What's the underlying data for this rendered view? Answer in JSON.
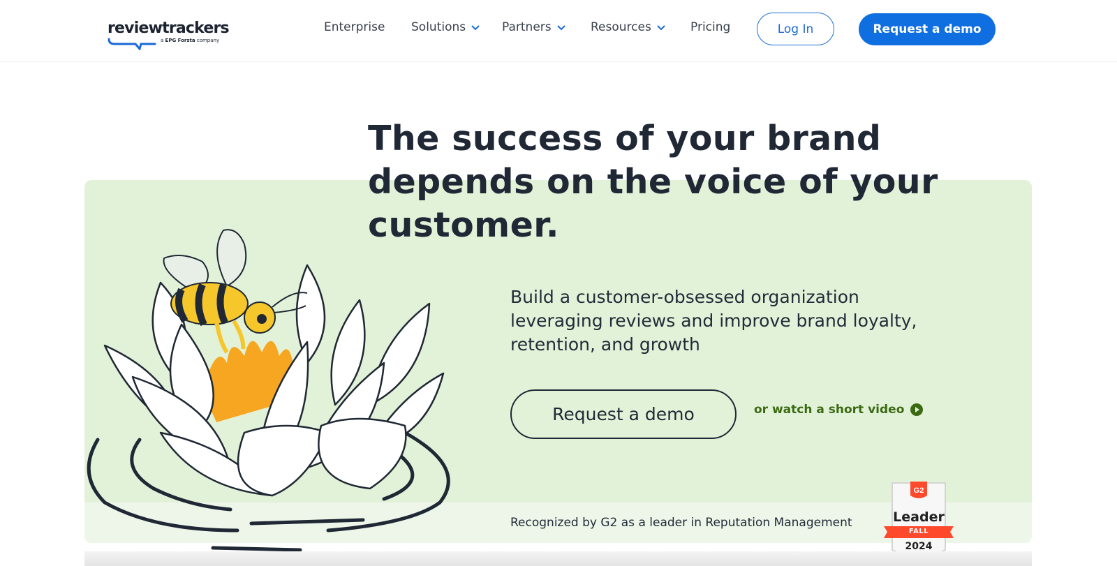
{
  "brand": {
    "name": "reviewtrackers",
    "tagline_prefix": "a",
    "tagline_company": "EPG Forsta",
    "tagline_suffix": "company",
    "accent_color": "#0f6fe0",
    "hero_bg_color": "#e2f2d9"
  },
  "nav": {
    "items": [
      {
        "label": "Enterprise",
        "has_dropdown": false
      },
      {
        "label": "Solutions",
        "has_dropdown": true
      },
      {
        "label": "Partners",
        "has_dropdown": true
      },
      {
        "label": "Resources",
        "has_dropdown": true
      },
      {
        "label": "Pricing",
        "has_dropdown": false
      }
    ],
    "login_label": "Log In",
    "demo_label": "Request a demo"
  },
  "hero": {
    "headline": "The success of your brand depends on the voice of your customer.",
    "subtext": "Build a customer-obsessed organization leveraging reviews and improve brand loyalty, retention, and growth",
    "cta_label": "Request a demo",
    "video_link_label": "or watch a short video",
    "recognized_text": "Recognized by G2 as a leader in Reputation Management",
    "illustration_icon": "bee-on-lotus-illustration"
  },
  "badge": {
    "logo": "G2",
    "title": "Leader",
    "season": "FALL",
    "year": "2024",
    "ribbon_color": "#ff492c"
  }
}
